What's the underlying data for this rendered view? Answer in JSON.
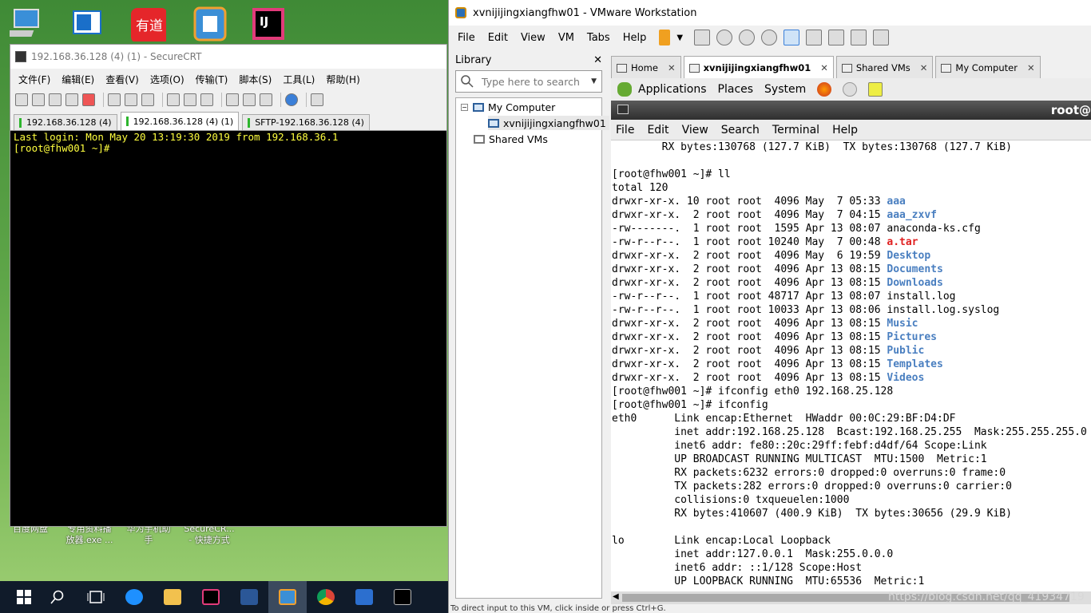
{
  "desktop": {
    "icons": [
      "computer-icon",
      "vm-icon",
      "youdao-icon",
      "vmware-icon",
      "intellij-icon"
    ],
    "icon_labels": [
      {
        "text1": "百度网盘",
        "text2": ""
      },
      {
        "text1": "专用资料播",
        "text2": "放器.exe ..."
      },
      {
        "text1": "华为手机助",
        "text2": "手"
      },
      {
        "text1": "SecureCR...",
        "text2": "- 快捷方式"
      }
    ]
  },
  "securecrt": {
    "title": "192.168.36.128 (4) (1) - SecureCRT",
    "menu": [
      "文件(F)",
      "编辑(E)",
      "查看(V)",
      "选项(O)",
      "传输(T)",
      "脚本(S)",
      "工具(L)",
      "帮助(H)"
    ],
    "tabs": [
      {
        "label": "192.168.36.128 (4)",
        "active": false
      },
      {
        "label": "192.168.36.128 (4) (1)",
        "active": true
      },
      {
        "label": "SFTP-192.168.36.128 (4)",
        "active": false
      }
    ],
    "terminal_lines": [
      "Last login: Mon May 20 13:19:30 2019 from 192.168.36.1",
      "[root@fhw001 ~]# "
    ]
  },
  "vmware": {
    "title": "xvnijijingxiangfhw01 - VMware Workstation",
    "menu": [
      "File",
      "Edit",
      "View",
      "VM",
      "Tabs",
      "Help"
    ],
    "library": {
      "header": "Library",
      "close": "✕",
      "search_placeholder": "Type here to search",
      "tree": {
        "root": "My Computer",
        "vm": "xvnijijingxiangfhw01",
        "shared": "Shared VMs"
      }
    },
    "tabs": [
      {
        "label": "Home",
        "active": false
      },
      {
        "label": "xvnijijingxiangfhw01",
        "active": true
      },
      {
        "label": "Shared VMs",
        "active": false
      },
      {
        "label": "My Computer",
        "active": false
      }
    ],
    "gnome_panel": [
      "Applications",
      "Places",
      "System"
    ],
    "terminal_title": "root@",
    "terminal_menu": [
      "File",
      "Edit",
      "View",
      "Search",
      "Terminal",
      "Help"
    ],
    "terminal_output": [
      {
        "t": "        RX bytes:130768 (127.7 KiB)  TX bytes:130768 (127.7 KiB)"
      },
      {
        "t": ""
      },
      {
        "t": "[root@fhw001 ~]# ll"
      },
      {
        "t": "total 120"
      },
      {
        "t": "drwxr-xr-x. 10 root root  4096 May  7 05:33 ",
        "f": "aaa",
        "c": "blue"
      },
      {
        "t": "drwxr-xr-x.  2 root root  4096 May  7 04:15 ",
        "f": "aaa_zxvf",
        "c": "blue"
      },
      {
        "t": "-rw-------.  1 root root  1595 Apr 13 08:07 anaconda-ks.cfg"
      },
      {
        "t": "-rw-r--r--.  1 root root 10240 May  7 00:48 ",
        "f": "a.tar",
        "c": "red"
      },
      {
        "t": "drwxr-xr-x.  2 root root  4096 May  6 19:59 ",
        "f": "Desktop",
        "c": "blue"
      },
      {
        "t": "drwxr-xr-x.  2 root root  4096 Apr 13 08:15 ",
        "f": "Documents",
        "c": "blue"
      },
      {
        "t": "drwxr-xr-x.  2 root root  4096 Apr 13 08:15 ",
        "f": "Downloads",
        "c": "blue"
      },
      {
        "t": "-rw-r--r--.  1 root root 48717 Apr 13 08:07 install.log"
      },
      {
        "t": "-rw-r--r--.  1 root root 10033 Apr 13 08:06 install.log.syslog"
      },
      {
        "t": "drwxr-xr-x.  2 root root  4096 Apr 13 08:15 ",
        "f": "Music",
        "c": "blue"
      },
      {
        "t": "drwxr-xr-x.  2 root root  4096 Apr 13 08:15 ",
        "f": "Pictures",
        "c": "blue"
      },
      {
        "t": "drwxr-xr-x.  2 root root  4096 Apr 13 08:15 ",
        "f": "Public",
        "c": "blue"
      },
      {
        "t": "drwxr-xr-x.  2 root root  4096 Apr 13 08:15 ",
        "f": "Templates",
        "c": "blue"
      },
      {
        "t": "drwxr-xr-x.  2 root root  4096 Apr 13 08:15 ",
        "f": "Videos",
        "c": "blue"
      },
      {
        "t": "[root@fhw001 ~]# ifconfig eth0 192.168.25.128"
      },
      {
        "t": "[root@fhw001 ~]# ifconfig"
      },
      {
        "t": "eth0      Link encap:Ethernet  HWaddr 00:0C:29:BF:D4:DF"
      },
      {
        "t": "          inet addr:192.168.25.128  Bcast:192.168.25.255  Mask:255.255.255.0"
      },
      {
        "t": "          inet6 addr: fe80::20c:29ff:febf:d4df/64 Scope:Link"
      },
      {
        "t": "          UP BROADCAST RUNNING MULTICAST  MTU:1500  Metric:1"
      },
      {
        "t": "          RX packets:6232 errors:0 dropped:0 overruns:0 frame:0"
      },
      {
        "t": "          TX packets:282 errors:0 dropped:0 overruns:0 carrier:0"
      },
      {
        "t": "          collisions:0 txqueuelen:1000"
      },
      {
        "t": "          RX bytes:410607 (400.9 KiB)  TX bytes:30656 (29.9 KiB)"
      },
      {
        "t": ""
      },
      {
        "t": "lo        Link encap:Local Loopback"
      },
      {
        "t": "          inet addr:127.0.0.1  Mask:255.0.0.0"
      },
      {
        "t": "          inet6 addr: ::1/128 Scope:Host"
      },
      {
        "t": "          UP LOOPBACK RUNNING  MTU:65536  Metric:1"
      }
    ],
    "status_text": "To direct input to this VM, click inside or press Ctrl+G.",
    "watermark": "https://blog.csdn.net/qq_41934719"
  },
  "colors": {
    "terminal_fg": "#ffff3f",
    "dir_blue": "#4a7fc0",
    "archive_red": "#e02020",
    "taskbar": "#101b2a"
  }
}
